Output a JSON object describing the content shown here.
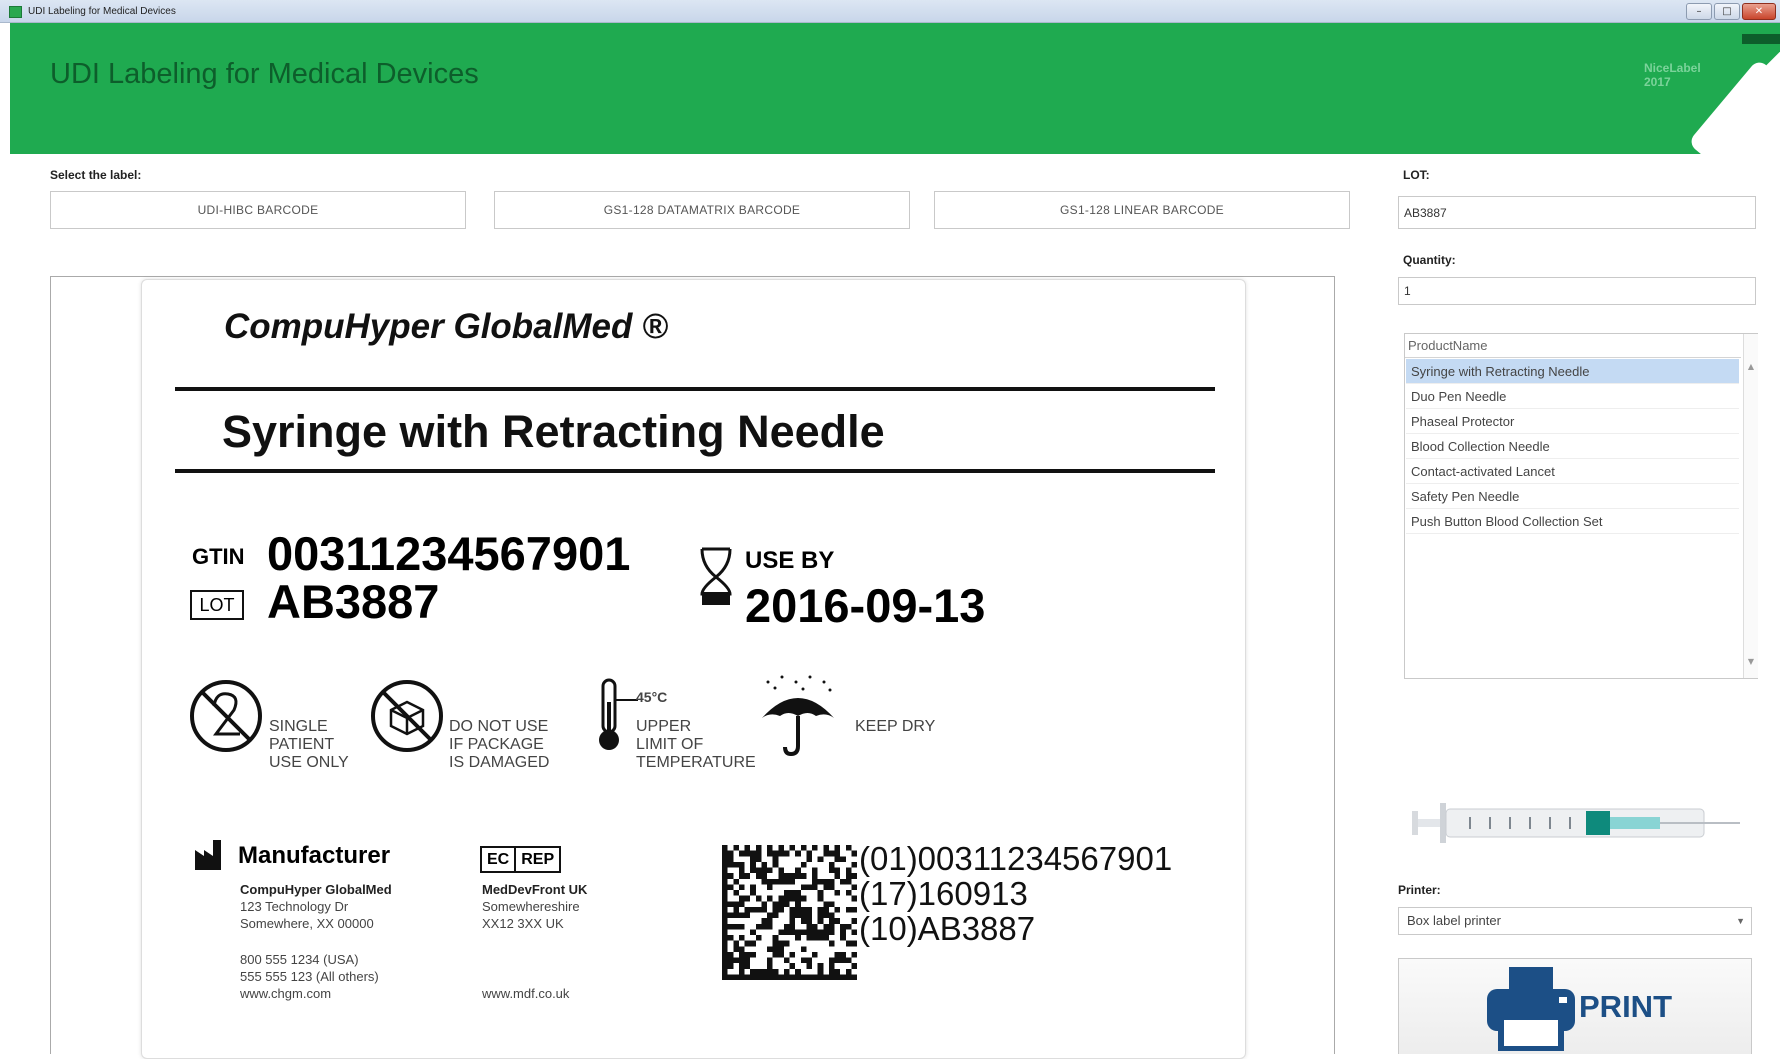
{
  "window": {
    "title": "UDI Labeling for Medical Devices",
    "controls": [
      "–",
      "□",
      "✕"
    ]
  },
  "header": {
    "title": "UDI Labeling for Medical Devices",
    "brand": "NiceLabel",
    "brand_year": "2017"
  },
  "select_label": {
    "title": "Select the label:",
    "options": [
      "UDI-HIBC BARCODE",
      "GS1-128 DATAMATRIX BARCODE",
      "GS1-128 LINEAR BARCODE"
    ]
  },
  "label": {
    "company": "CompuHyper GlobalMed ®",
    "product": "Syringe with Retracting Needle",
    "gtin_label": "GTIN",
    "gtin": "00311234567901",
    "lot_label": "LOT",
    "lot": "AB3887",
    "use_by_label": "USE BY",
    "use_by": "2016-09-13",
    "symbols": {
      "single_patient": [
        "SINGLE",
        "PATIENT",
        "USE ONLY"
      ],
      "damaged": [
        "DO NOT USE",
        "IF PACKAGE",
        "IS DAMAGED"
      ],
      "temp_value": "45°C",
      "temperature": [
        "UPPER",
        "LIMIT OF",
        "TEMPERATURE"
      ],
      "keep_dry": "KEEP DRY"
    },
    "manufacturer": {
      "title": "Manufacturer",
      "name": "CompuHyper GlobalMed",
      "address": [
        "123 Technology Dr",
        "Somewhere, XX 00000"
      ],
      "phones": [
        "800 555 1234 (USA)",
        "555 555 123 (All others)"
      ],
      "web": "www.chgm.com"
    },
    "ec_rep": {
      "ec": "EC",
      "rep": "REP",
      "name": "MedDevFront UK",
      "address": [
        "Somewhereshire",
        "XX12 3XX UK"
      ],
      "web": "www.mdf.co.uk"
    },
    "hri": [
      "(01)00311234567901",
      "(17)160913",
      "(10)AB3887"
    ]
  },
  "right_panel": {
    "lot_label": "LOT:",
    "lot_value": "AB3887",
    "quantity_label": "Quantity:",
    "quantity_value": "1",
    "list_header": "ProductName",
    "products": [
      "Syringe with Retracting Needle",
      "Duo Pen Needle",
      "Phaseal Protector",
      "Blood Collection Needle",
      "Contact-activated Lancet",
      "Safety Pen Needle",
      "Push Button Blood Collection Set"
    ],
    "selected_product": "Syringe with Retracting Needle",
    "printer_label": "Printer:",
    "printer_value": "Box label printer",
    "print_label": "PRINT"
  },
  "colors": {
    "header_green": "#1faa50",
    "title_green": "#0d5e2b",
    "selection": "#c4daf3",
    "print_blue": "#1c4f86"
  },
  "icons": [
    "app-icon",
    "hourglass-icon",
    "single-use-icon",
    "damaged-package-icon",
    "thermometer-icon",
    "umbrella-icon",
    "manufacturer-icon",
    "printer-icon",
    "dropdown-arrow-icon"
  ]
}
